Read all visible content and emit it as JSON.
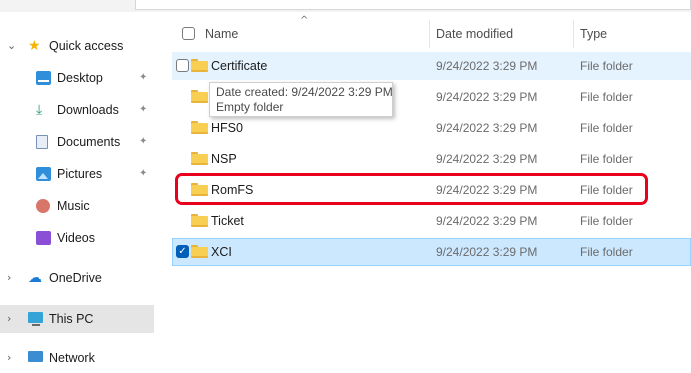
{
  "nav": {
    "quick_access": "Quick access",
    "desktop": "Desktop",
    "downloads": "Downloads",
    "documents": "Documents",
    "pictures": "Pictures",
    "music": "Music",
    "videos": "Videos",
    "onedrive": "OneDrive",
    "this_pc": "This PC",
    "network": "Network"
  },
  "columns": {
    "name": "Name",
    "date_modified": "Date modified",
    "type": "Type"
  },
  "rows": [
    {
      "name": "Certificate",
      "date": "9/24/2022 3:29 PM",
      "type": "File folder"
    },
    {
      "name": "",
      "date": "9/24/2022 3:29 PM",
      "type": "File folder"
    },
    {
      "name": "HFS0",
      "date": "9/24/2022 3:29 PM",
      "type": "File folder"
    },
    {
      "name": "NSP",
      "date": "9/24/2022 3:29 PM",
      "type": "File folder"
    },
    {
      "name": "RomFS",
      "date": "9/24/2022 3:29 PM",
      "type": "File folder"
    },
    {
      "name": "Ticket",
      "date": "9/24/2022 3:29 PM",
      "type": "File folder"
    },
    {
      "name": "XCI",
      "date": "9/24/2022 3:29 PM",
      "type": "File folder"
    }
  ],
  "tooltip": {
    "line1": "Date created: 9/24/2022 3:29 PM",
    "line2": "Empty folder"
  },
  "colors": {
    "accent": "#005fb8",
    "highlight_border": "#e8001c",
    "selected_row": "#cce8ff",
    "hover_row": "#e5f3ff",
    "folder": "#f8cf52"
  },
  "icons": [
    "star-icon",
    "desktop-icon",
    "download-icon",
    "documents-icon",
    "pictures-icon",
    "music-icon",
    "videos-icon",
    "onedrive-icon",
    "this-pc-icon",
    "network-icon",
    "folder-icon",
    "pin-icon",
    "chevron-right-icon",
    "chevron-down-icon",
    "sort-up-icon"
  ]
}
